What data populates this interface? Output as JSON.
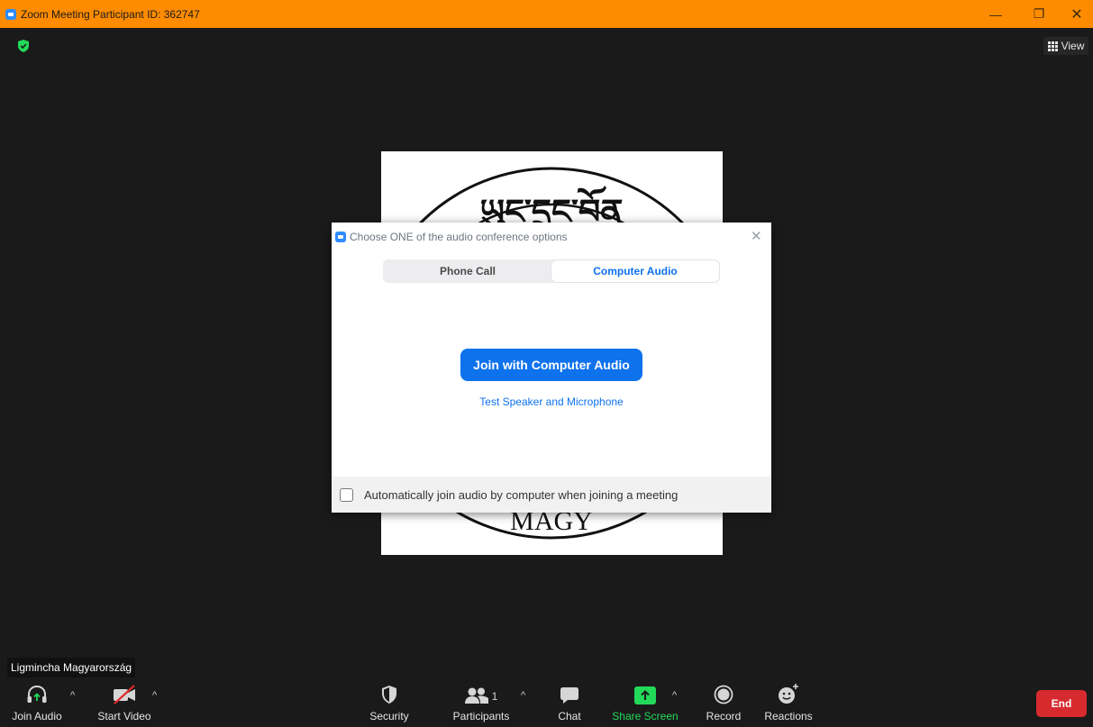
{
  "window": {
    "title": "Zoom Meeting Participant ID: 362747",
    "minimize_glyph": "—",
    "maximize_glyph": "❐",
    "close_glyph": "✕",
    "accent": "#ff8c00"
  },
  "header": {
    "view_label": "View",
    "security_shield_color": "#23d959"
  },
  "participant": {
    "name": "Ligmincha Magyarország",
    "tile_text_top": "ཡུང་དྲུང་བོན",
    "tile_text_bottom": "MAGY"
  },
  "dialog": {
    "title": "Choose ONE of the audio conference options",
    "close_glyph": "✕",
    "tabs": [
      {
        "label": "Phone Call",
        "selected": false
      },
      {
        "label": "Computer Audio",
        "selected": true
      }
    ],
    "join_button": "Join with Computer Audio",
    "test_link": "Test Speaker and Microphone",
    "auto_join_label": "Automatically join audio by computer when joining a meeting",
    "auto_join_checked": false,
    "accent": "#0e72ed"
  },
  "toolbar": {
    "join_audio": "Join Audio",
    "start_video": "Start Video",
    "security": "Security",
    "participants": "Participants",
    "participants_count": "1",
    "chat": "Chat",
    "share_screen": "Share Screen",
    "record": "Record",
    "reactions": "Reactions",
    "end": "End",
    "caret_glyph": "^",
    "share_color": "#23d959",
    "end_color": "#d62a2f"
  }
}
